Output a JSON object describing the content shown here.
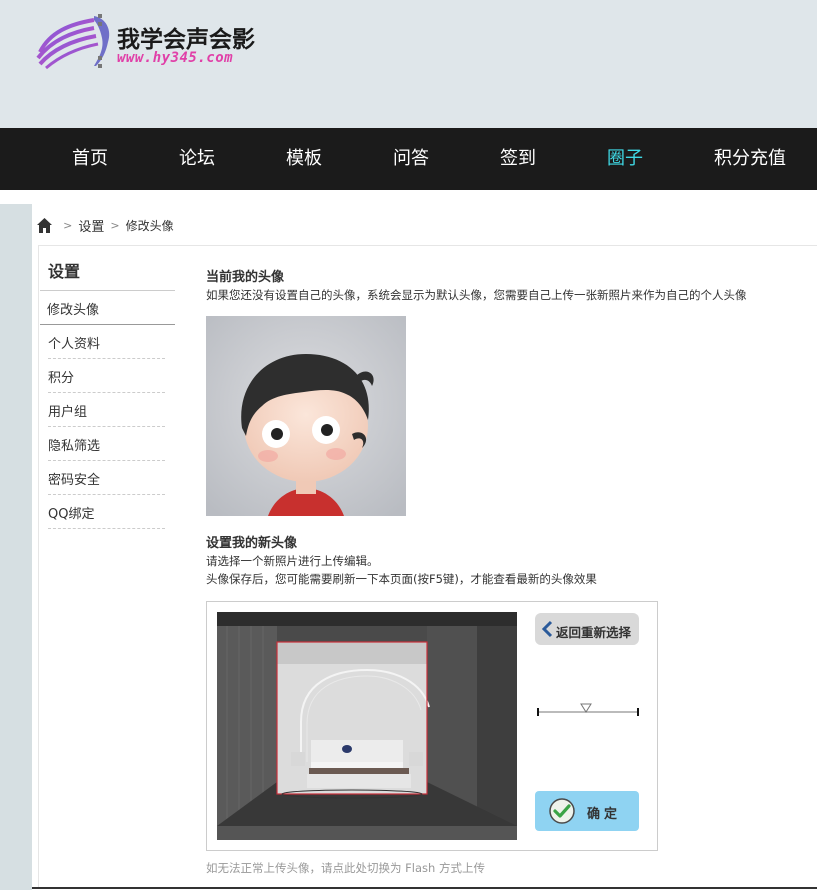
{
  "site": {
    "name": "我学会声会影",
    "url": "www.hy345.com"
  },
  "nav": {
    "items": [
      {
        "label": "首页"
      },
      {
        "label": "论坛"
      },
      {
        "label": "模板"
      },
      {
        "label": "问答"
      },
      {
        "label": "签到"
      },
      {
        "label": "圈子",
        "active": true
      },
      {
        "label": "积分充值"
      }
    ],
    "active_color": "#3fd8e4"
  },
  "breadcrumb": {
    "items": [
      "设置",
      "修改头像"
    ]
  },
  "sidebar": {
    "title": "设置",
    "active": "修改头像",
    "items": [
      "个人资料",
      "积分",
      "用户组",
      "隐私筛选",
      "密码安全",
      "QQ绑定"
    ]
  },
  "current_avatar": {
    "title": "当前我的头像",
    "desc": "如果您还没有设置自己的头像，系统会显示为默认头像，您需要自己上传一张新照片来作为自己的个人头像"
  },
  "new_avatar": {
    "title": "设置我的新头像",
    "line1": "请选择一个新照片进行上传编辑。",
    "line2": "头像保存后，您可能需要刷新一下本页面(按F5键)，才能查看最新的头像效果"
  },
  "uploader": {
    "back_label": "返回重新选择",
    "ok_label": "确定"
  },
  "flash_note": "如无法正常上传头像，请点此处切换为 Flash 方式上传"
}
